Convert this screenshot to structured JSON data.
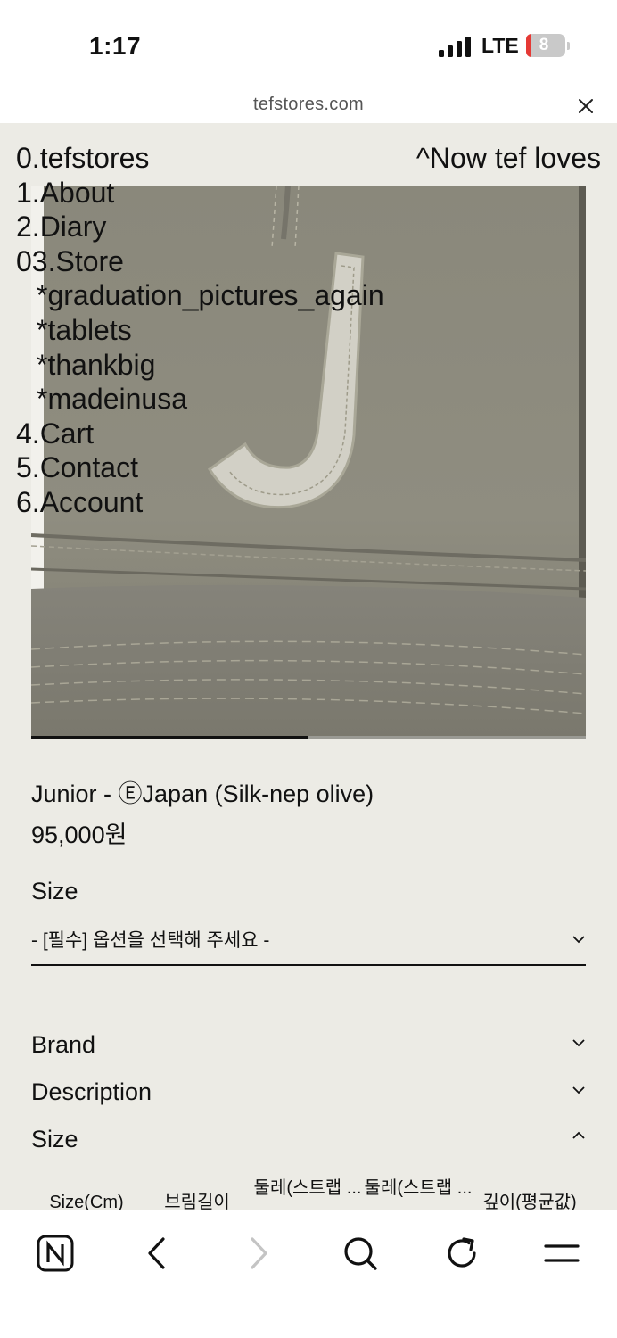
{
  "status_bar": {
    "time": "1:17",
    "network": "LTE",
    "battery": "8"
  },
  "browser": {
    "url": "tefstores.com"
  },
  "nav": {
    "items": [
      "0.tefstores",
      "1.About",
      "2.Diary",
      "03.Store"
    ],
    "store_sub": [
      "*graduation_pictures_again",
      "*tablets",
      "*thankbig",
      "*madeinusa"
    ],
    "items_after": [
      "4.Cart",
      "5.Contact",
      "6.Account"
    ],
    "now_loves": "^Now tef loves"
  },
  "product": {
    "title": "Junior - ⒺJapan (Silk-nep olive)",
    "price": "95,000원",
    "image_progress": 0.5,
    "option": {
      "label": "Size",
      "placeholder": "- [필수] 옵션을 선택해 주세요 -"
    },
    "accordions": [
      {
        "label": "Brand",
        "state": "collapsed"
      },
      {
        "label": "Description",
        "state": "collapsed"
      },
      {
        "label": "Size",
        "state": "expanded"
      }
    ],
    "size_table_headers": [
      "Size(Cm)",
      "브림길이",
      "둘레(스트랩 ...",
      "둘레(스트랩 ...",
      "깊이(평균값)"
    ]
  },
  "toolbar": {
    "icons": [
      "naver-home-icon",
      "back-icon",
      "forward-icon",
      "search-icon",
      "reload-icon",
      "menu-icon"
    ]
  },
  "colors": {
    "page_bg": "#ecebe5",
    "cap_olive": "#8d8b7e",
    "text": "#111111"
  }
}
